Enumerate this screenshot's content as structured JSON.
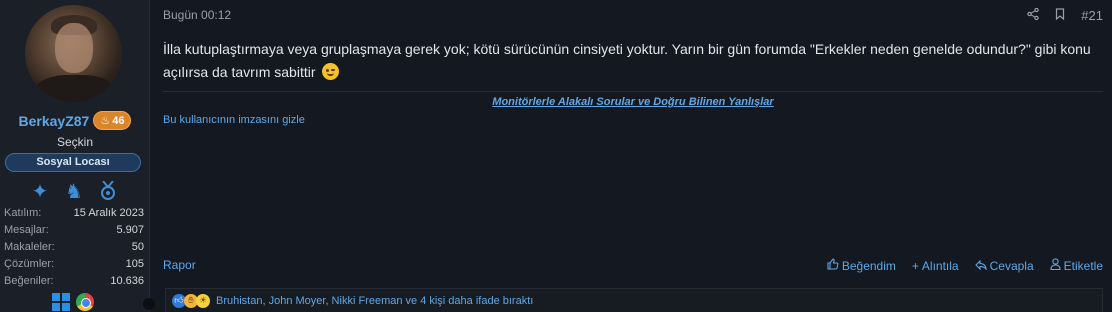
{
  "user": {
    "username": "BerkayZ87",
    "score": "46",
    "rank": "Seçkin",
    "group": "Sosyal Locası",
    "trophies": [
      "star-trophy-icon",
      "knight-trophy-icon",
      "medal-trophy-icon"
    ],
    "stats": [
      {
        "label": "Katılım:",
        "value": "15 Aralık 2023"
      },
      {
        "label": "Mesajlar:",
        "value": "5.907"
      },
      {
        "label": "Makaleler:",
        "value": "50"
      },
      {
        "label": "Çözümler:",
        "value": "105"
      },
      {
        "label": "Beğeniler:",
        "value": "10.636"
      }
    ],
    "system_icons": [
      "windows-icon",
      "chrome-icon"
    ]
  },
  "post": {
    "date": "Bugün 00:12",
    "number": "#21",
    "body": "İlla kutuplaştırmaya veya gruplaşmaya gerek yok; kötü sürücünün cinsiyeti yoktur. Yarın bir gün forumda \"Erkekler neden genelde odundur?\" gibi konu açılırsa da tavrım sabittir",
    "signature_link": "Monitörlerle Alakalı Sorular ve Doğru Bilinen Yanlışlar",
    "hide_signature": "Bu kullanıcının imzasını gizle"
  },
  "footer": {
    "report": "Rapor",
    "like": "Beğendim",
    "quote": "Alıntıla",
    "reply": "Cevapla",
    "tag": "Etiketle"
  },
  "reactions": {
    "text": "Bruhistan, John Moyer, Nikki Freeman ve 4 kişi daha ifade bıraktı"
  },
  "colors": {
    "accent": "#5fa8e8",
    "background": "#141820",
    "badge": "#d9852a"
  }
}
